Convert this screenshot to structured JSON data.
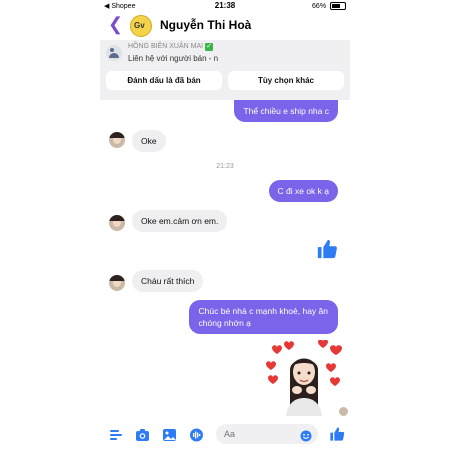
{
  "status_bar": {
    "carrier": "◀ Shopee",
    "time": "21:38",
    "battery": "66%"
  },
  "header": {
    "contact_name": "Nguyễn Thi Hoà",
    "avatar_text": "Gv"
  },
  "banner": {
    "shop_name": "HỒNG BIÊN XUÂN MAI",
    "subtitle": "Liên hệ với người bán - n",
    "mark_sold_button": "Đánh dấu là đã bán",
    "other_options_button": "Tùy chọn khác"
  },
  "messages": [
    {
      "side": "out",
      "text": "Thể chiều e ship nha c"
    },
    {
      "side": "in",
      "text": "Oke"
    },
    {
      "timestamp": "21:23"
    },
    {
      "side": "out",
      "text": "C đi xe ok k ạ"
    },
    {
      "side": "in",
      "text": "Oke em.cảm ơn em."
    },
    {
      "side": "out",
      "type": "thumbs-up"
    },
    {
      "side": "in",
      "text": "Cháu rất thích"
    },
    {
      "side": "out",
      "text_line1": "Chúc bé nhà c mạnh khoẻ, hay ăn",
      "text_line2": "chóng nhớn ạ"
    },
    {
      "side": "out",
      "type": "sticker"
    }
  ],
  "composer": {
    "placeholder": "Aa"
  },
  "colors": {
    "accent": "#7b63ea",
    "icon_blue": "#2f7bf5",
    "back": "#7c4dcc"
  },
  "icons": [
    "back-chevron-icon",
    "menu-icon",
    "camera-icon",
    "image-icon",
    "microphone-icon",
    "emoji-icon",
    "thumbs-up-icon"
  ]
}
